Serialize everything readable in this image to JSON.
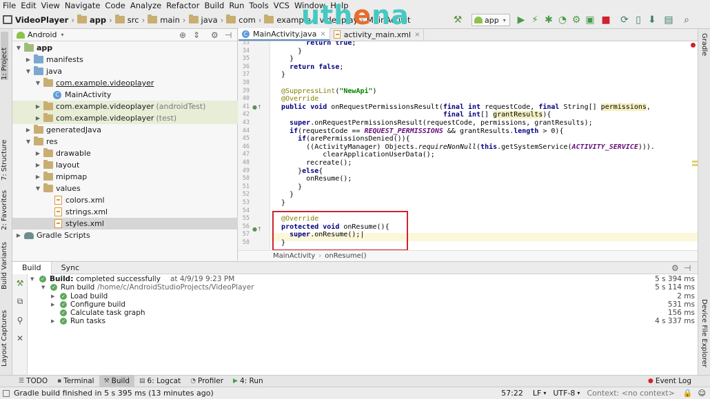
{
  "menu": [
    "File",
    "Edit",
    "View",
    "Navigate",
    "Code",
    "Analyze",
    "Refactor",
    "Build",
    "Run",
    "Tools",
    "VCS",
    "Window",
    "Help"
  ],
  "nav": {
    "project": "VideoPlayer",
    "crumbs": [
      "app",
      "src",
      "main",
      "java",
      "com",
      "example",
      "videoplay",
      "MainActivit"
    ],
    "run_config": "app"
  },
  "logo": {
    "part1": "uth",
    "part2": "e",
    "part3": "na"
  },
  "project_panel": {
    "view": "Android",
    "tree": [
      {
        "label": "app",
        "bold": true
      },
      {
        "label": "manifests"
      },
      {
        "label": "java"
      },
      {
        "label": "com.example.videoplayer"
      },
      {
        "label": "MainActivity"
      },
      {
        "label": "com.example.videoplayer",
        "suffix": "(androidTest)"
      },
      {
        "label": "com.example.videoplayer",
        "suffix": "(test)"
      },
      {
        "label": "generatedJava"
      },
      {
        "label": "res"
      },
      {
        "label": "drawable"
      },
      {
        "label": "layout"
      },
      {
        "label": "mipmap"
      },
      {
        "label": "values"
      },
      {
        "label": "colors.xml"
      },
      {
        "label": "strings.xml"
      },
      {
        "label": "styles.xml"
      },
      {
        "label": "Gradle Scripts"
      }
    ]
  },
  "editor": {
    "tabs": [
      {
        "label": "MainActivity.java",
        "active": true
      },
      {
        "label": "activity_main.xml",
        "active": false
      }
    ],
    "line_numbers": [
      "33",
      "34",
      "35",
      "36",
      "37",
      "38",
      "39",
      "40",
      "41",
      "42",
      "43",
      "44",
      "45",
      "46",
      "47",
      "48",
      "49",
      "50",
      "51",
      "52",
      "53",
      "54",
      "55",
      "56",
      "57",
      "58"
    ],
    "breadcrumb": [
      "MainActivity",
      "onResume()"
    ]
  },
  "left_strip": [
    "1: Project",
    "7: Structure",
    "2: Favorites",
    "Build Variants",
    "Layout Captures"
  ],
  "right_strip": [
    "Gradle",
    "Device File Explorer"
  ],
  "build": {
    "tabs": [
      "Build",
      "Sync"
    ],
    "rows": [
      {
        "label": "Build:",
        "rest": "completed successfully",
        "at": "at 4/9/19 9:23 PM",
        "time": "5 s 394 ms"
      },
      {
        "label": "Run build",
        "rest": "/home/c/AndroidStudioProjects/VideoPlayer",
        "time": "5 s 114 ms"
      },
      {
        "label": "Load build",
        "time": "2 ms"
      },
      {
        "label": "Configure build",
        "time": "531 ms"
      },
      {
        "label": "Calculate task graph",
        "time": "156 ms"
      },
      {
        "label": "Run tasks",
        "time": "4 s 337 ms"
      }
    ]
  },
  "toolwindows": [
    "TODO",
    "Terminal",
    "Build",
    "6: Logcat",
    "Profiler",
    "4: Run"
  ],
  "event_log": "Event Log",
  "status": {
    "message": "Gradle build finished in 5 s 395 ms (13 minutes ago)",
    "position": "57:22",
    "line_sep": "LF",
    "encoding": "UTF-8",
    "context": "Context: <no context>"
  }
}
